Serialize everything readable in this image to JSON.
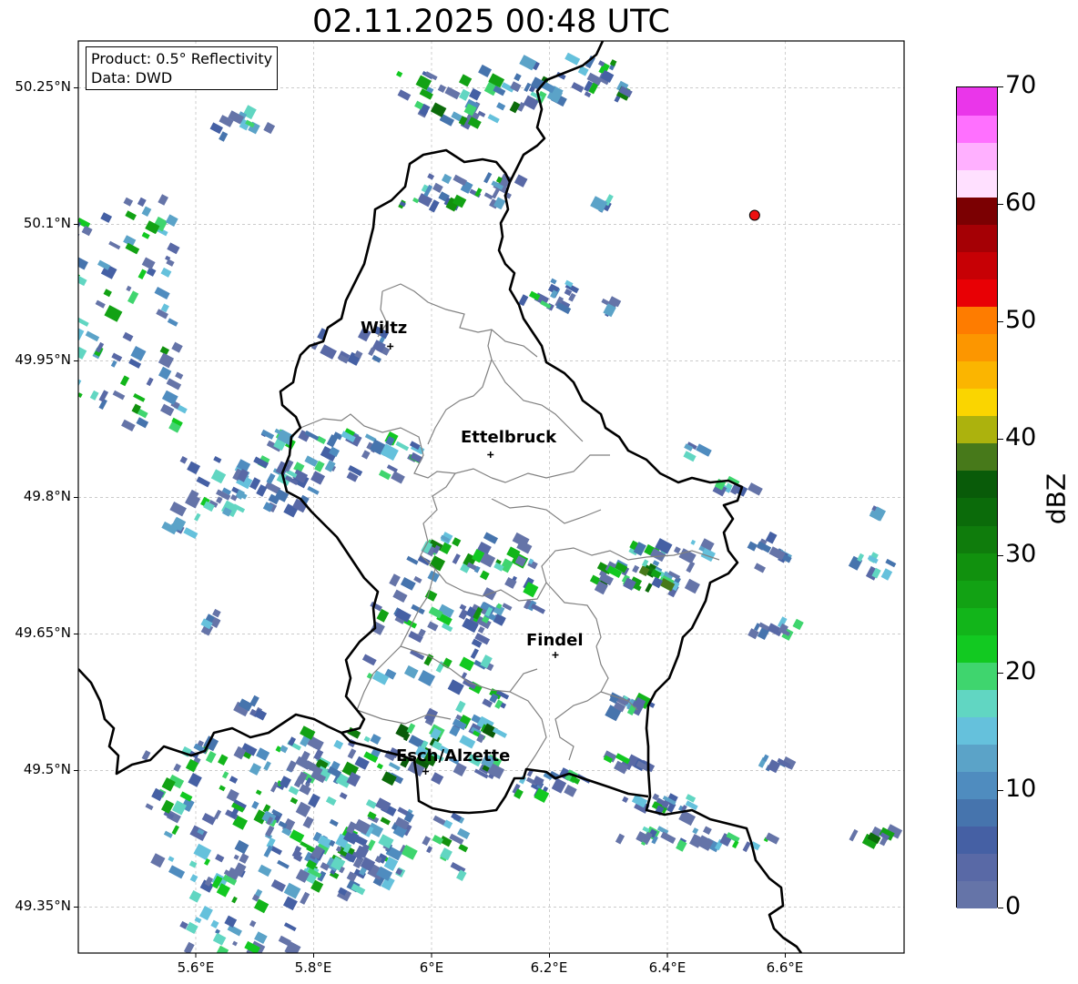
{
  "title": "02.11.2025 00:48 UTC",
  "info": {
    "product": "Product: 0.5° Reflectivity",
    "data": "Data: DWD"
  },
  "map": {
    "lon_range": [
      5.4,
      6.8
    ],
    "lat_range": [
      49.3,
      50.3
    ],
    "lat_ticks": [
      "50.25°N",
      "50.1°N",
      "49.95°N",
      "49.8°N",
      "49.65°N",
      "49.5°N",
      "49.35°N"
    ],
    "lon_ticks": [
      "5.6°E",
      "5.8°E",
      "6°E",
      "6.2°E",
      "6.4°E",
      "6.6°E"
    ],
    "cities": [
      {
        "name": "Wiltz",
        "lon": 5.93,
        "lat": 49.966
      },
      {
        "name": "Ettelbruck",
        "lon": 6.1,
        "lat": 49.847
      },
      {
        "name": "Findel",
        "lon": 6.21,
        "lat": 49.627
      },
      {
        "name": "Esch/Alzette",
        "lon": 5.99,
        "lat": 49.499
      }
    ],
    "radar_site": {
      "lon": 6.548,
      "lat": 50.11,
      "color": "#ee1111"
    },
    "border_color": "#000000",
    "canton_color": "#808080"
  },
  "colorbar": {
    "label": "dBZ",
    "ticks": [
      "0",
      "10",
      "20",
      "30",
      "40",
      "50",
      "60",
      "70"
    ],
    "min": 0,
    "max": 70,
    "step": 2.5,
    "colors": [
      "#6574a8",
      "#5969a6",
      "#4560a4",
      "#4674ad",
      "#4f8cbf",
      "#5ba3c8",
      "#65c1dc",
      "#61d6c2",
      "#3fd56e",
      "#12c921",
      "#12b51a",
      "#12a214",
      "#11910e",
      "#0f7c0c",
      "#0b6b0a",
      "#095b09",
      "#47791a",
      "#acb20d",
      "#fad500",
      "#fbb500",
      "#fc9600",
      "#fe7c00",
      "#e80005",
      "#c70005",
      "#a50005",
      "#7b0002",
      "#ffe0ff",
      "#ffb0ff",
      "#ff70ff",
      "#ea36ea"
    ]
  }
}
